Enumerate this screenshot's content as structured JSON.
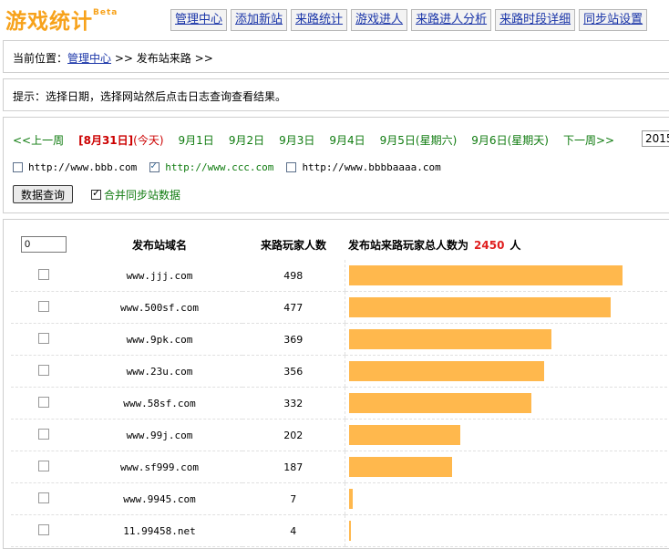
{
  "logo": {
    "text": "游戏统计",
    "badge": "Beta"
  },
  "nav": [
    "管理中心",
    "添加新站",
    "来路统计",
    "游戏进人",
    "来路进人分析",
    "来路时段详细",
    "同步站设置"
  ],
  "breadcrumb": {
    "prefix": "当前位置：",
    "link": "管理中心",
    "sep": ">>",
    "page": "发布站来路",
    "sep2": ">>"
  },
  "tip": "提示：选择日期，选择网站然后点击日志查询查看结果。",
  "dates": {
    "prev_week": "<<上一周",
    "current": "[8月31日]",
    "today": "(今天)",
    "days": [
      "9月1日",
      "9月2日",
      "9月3日",
      "9月4日",
      "9月5日(星期六)",
      "9月6日(星期天)"
    ],
    "next_week": "下一周>>",
    "year": "2015"
  },
  "sites": [
    {
      "url": "http://www.bbb.com",
      "checked": false
    },
    {
      "url": "http://www.ccc.com",
      "checked": true
    },
    {
      "url": "http://www.bbbbaaaa.com",
      "checked": false
    }
  ],
  "query_button": "数据查询",
  "merge_label": "合并同步站数据",
  "merge_checked": true,
  "table": {
    "input_value": "0",
    "col_domain": "发布站域名",
    "col_count": "来路玩家人数",
    "total_prefix": "发布站来路玩家总人数为",
    "total": "2450",
    "total_suffix": "人",
    "max_bar": 498,
    "rows": [
      {
        "domain": "www.jjj.com",
        "count": 498
      },
      {
        "domain": "www.500sf.com",
        "count": 477
      },
      {
        "domain": "www.9pk.com",
        "count": 369
      },
      {
        "domain": "www.23u.com",
        "count": 356
      },
      {
        "domain": "www.58sf.com",
        "count": 332
      },
      {
        "domain": "www.99j.com",
        "count": 202
      },
      {
        "domain": "www.sf999.com",
        "count": 187
      },
      {
        "domain": "www.9945.com",
        "count": 7
      },
      {
        "domain": "11.99458.net",
        "count": 4
      }
    ]
  }
}
